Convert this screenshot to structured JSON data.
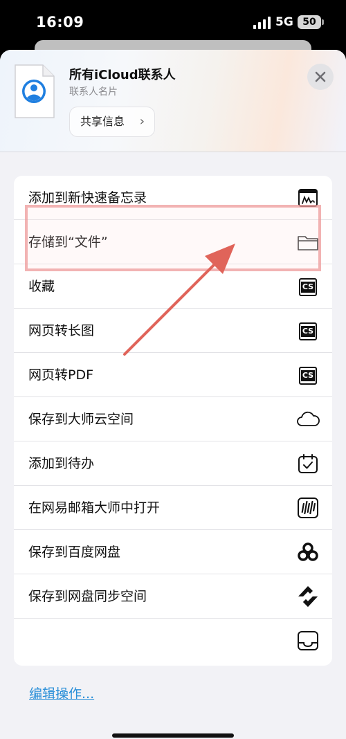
{
  "status_bar": {
    "time": "16:09",
    "network": "5G",
    "battery": "50"
  },
  "share_sheet": {
    "title": "所有iCloud联系人",
    "subtitle": "联系人名片",
    "share_button_label": "共享信息"
  },
  "actions": [
    {
      "label": "添加到新快速备忘录",
      "icon": "quick-note-icon"
    },
    {
      "label": "存储到“文件”",
      "icon": "folder-icon"
    },
    {
      "label": "收藏",
      "icon": "cs-icon"
    },
    {
      "label": "网页转长图",
      "icon": "cs-icon"
    },
    {
      "label": "网页转PDF",
      "icon": "cs-icon"
    },
    {
      "label": "保存到大师云空间",
      "icon": "cloud-icon"
    },
    {
      "label": "添加到待办",
      "icon": "calendar-check-icon"
    },
    {
      "label": "在网易邮箱大师中打开",
      "icon": "mail-master-icon"
    },
    {
      "label": "保存到百度网盘",
      "icon": "baidu-netdisk-icon"
    },
    {
      "label": "保存到网盘同步空间",
      "icon": "sync-space-icon"
    },
    {
      "label": "",
      "icon": "tray-icon"
    }
  ],
  "edit_actions_label": "编辑操作...",
  "annotation": {
    "highlight_color": "#ec9696",
    "arrow_color": "#e0645a"
  }
}
